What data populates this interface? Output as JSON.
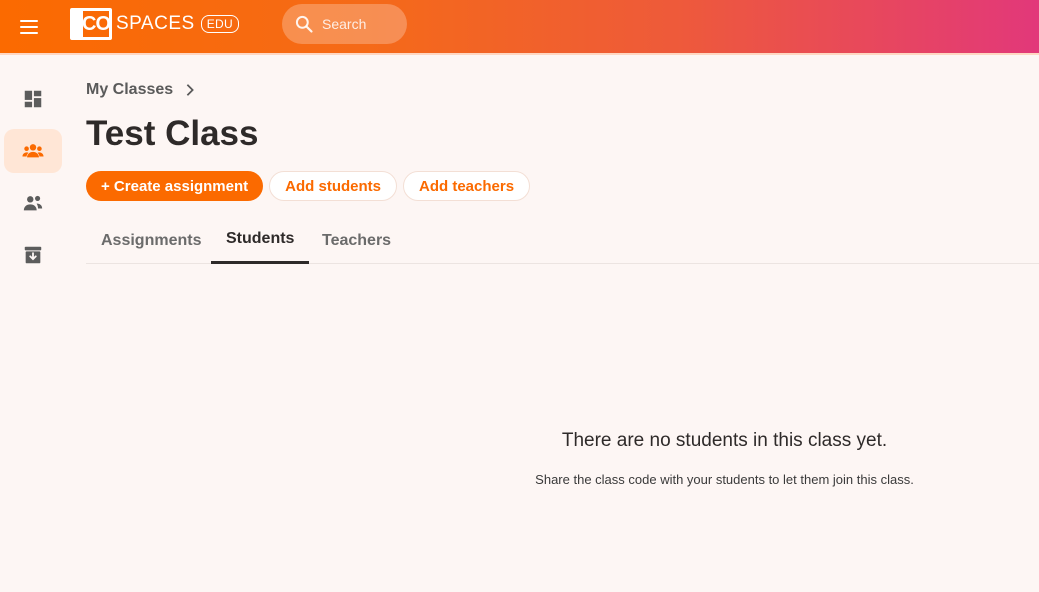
{
  "app": {
    "brand_word": "SPACES",
    "brand_badge": "EDU",
    "brand_box": "CO"
  },
  "search": {
    "placeholder": "Search"
  },
  "sidebar": {
    "items": [
      {
        "icon": "dashboard-icon",
        "active": false
      },
      {
        "icon": "classes-icon",
        "active": true
      },
      {
        "icon": "users-icon",
        "active": false
      },
      {
        "icon": "archive-icon",
        "active": false
      }
    ]
  },
  "breadcrumb": {
    "label": "My Classes"
  },
  "page": {
    "title": "Test Class"
  },
  "actions": {
    "create_assignment": "+ Create assignment",
    "add_students": "Add students",
    "add_teachers": "Add teachers"
  },
  "tabs": [
    {
      "label": "Assignments",
      "active": false
    },
    {
      "label": "Students",
      "active": true
    },
    {
      "label": "Teachers",
      "active": false
    }
  ],
  "empty_state": {
    "title": "There are no students in this class yet.",
    "subtitle": "Share the class code with your students to let them join this class."
  },
  "colors": {
    "accent": "#fb6a00",
    "gradient_end": "#e2387a",
    "text": "#2e2a29"
  }
}
